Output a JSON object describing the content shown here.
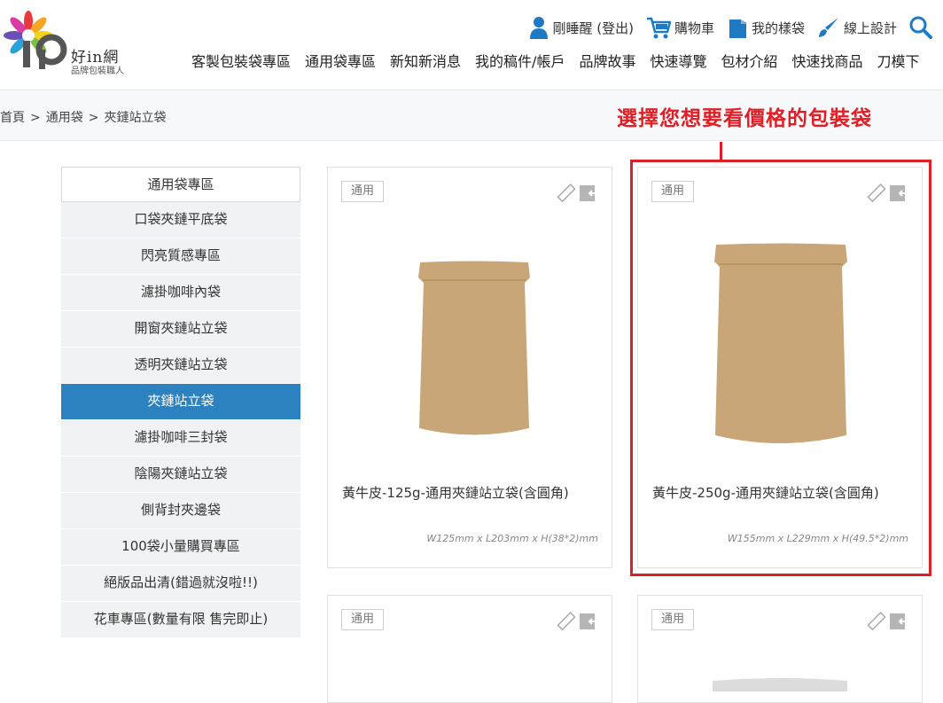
{
  "brand": {
    "name": "好in網",
    "tagline": "品牌包裝職人",
    "petal_colors": [
      "#e83a3a",
      "#f6a623",
      "#f2d21c",
      "#7bc043",
      "#2ba2d8",
      "#6a4fb6",
      "#d93aa3"
    ]
  },
  "top_links": [
    {
      "label": "剛睡醒 (登出)",
      "icon": "user-icon"
    },
    {
      "label": "購物車",
      "icon": "cart-icon"
    },
    {
      "label": "我的樣袋",
      "icon": "bag-icon"
    },
    {
      "label": "線上設計",
      "icon": "brush-icon"
    }
  ],
  "nav": [
    "客製包裝袋專區",
    "通用袋專區",
    "新知新消息",
    "我的稿件/帳戶",
    "品牌故事",
    "快速導覽",
    "包材介紹",
    "快速找商品",
    "刀模下"
  ],
  "breadcrumb": [
    "首頁",
    "通用袋",
    "夾鏈站立袋"
  ],
  "annotation": "選擇您想要看價格的包裝袋",
  "sidebar": {
    "header": "通用袋專區",
    "items": [
      "口袋夾鏈平底袋",
      "閃亮質感專區",
      "濾掛咖啡內袋",
      "開窗夾鏈站立袋",
      "透明夾鏈站立袋",
      "夾鏈站立袋",
      "濾掛咖啡三封袋",
      "陰陽夾鏈站立袋",
      "側背封夾邊袋",
      "100袋小量購買專區",
      "絕版品出清(錯過就沒啦!!)",
      "花車專區(數量有限 售完即止)"
    ],
    "active_index": 5
  },
  "products": [
    {
      "tag": "通用",
      "title": "黃牛皮-125g-通用夾鏈站立袋(含圓角)",
      "dims": "W125mm x L203mm x H(38*2)mm"
    },
    {
      "tag": "通用",
      "title": "黃牛皮-250g-通用夾鏈站立袋(含圓角)",
      "dims": "W155mm x L229mm x H(49.5*2)mm"
    },
    {
      "tag": "通用",
      "title": "",
      "dims": ""
    },
    {
      "tag": "通用",
      "title": "",
      "dims": ""
    }
  ],
  "colors": {
    "accent": "#2c82c0",
    "annotation_red": "#e01e26",
    "kraft": "#c9a677"
  }
}
